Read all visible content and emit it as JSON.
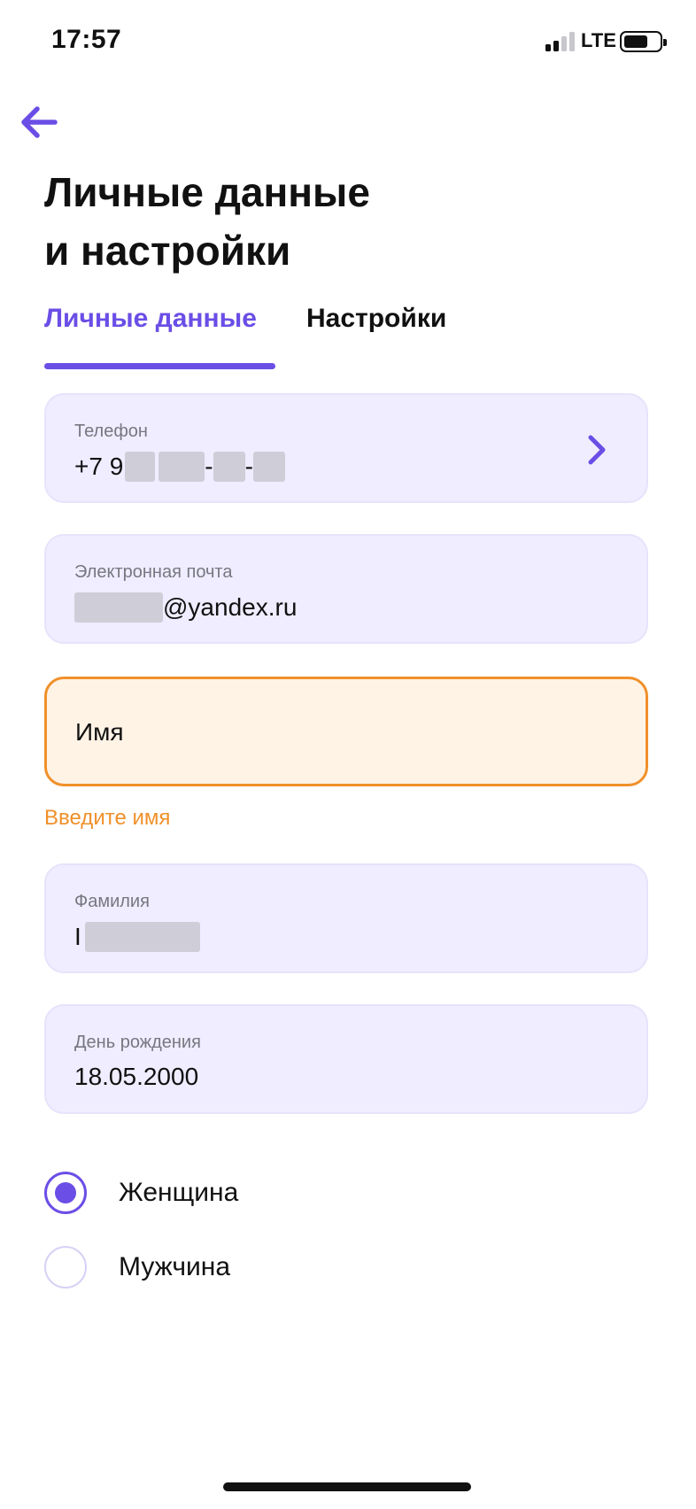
{
  "status_bar": {
    "time": "17:57",
    "network": "LTE",
    "icons": [
      "signal-icon",
      "battery-icon"
    ]
  },
  "header": {
    "back_icon": "arrow-left-icon",
    "title_line1": "Личные данные",
    "title_line2": "и настройки"
  },
  "tabs": [
    {
      "label": "Личные данные",
      "active": true
    },
    {
      "label": "Настройки",
      "active": false
    }
  ],
  "fields": {
    "phone": {
      "label": "Телефон",
      "prefix": "+7 9",
      "masked": true,
      "chevron_icon": "chevron-right-icon"
    },
    "email": {
      "label": "Электронная почта",
      "suffix": "@yandex.ru",
      "masked": true
    },
    "name": {
      "placeholder": "Имя",
      "error": "Введите имя",
      "state": "error"
    },
    "lastname": {
      "label": "Фамилия",
      "prefix": "I",
      "masked": true
    },
    "birthday": {
      "label": "День рождения",
      "value": "18.05.2000"
    }
  },
  "gender": {
    "options": [
      {
        "label": "Женщина",
        "selected": true
      },
      {
        "label": "Мужчина",
        "selected": false
      }
    ]
  },
  "colors": {
    "accent": "#6b4ee6",
    "field_bg": "#efedff",
    "error": "#f0902a",
    "error_bg": "#fff3e6"
  }
}
